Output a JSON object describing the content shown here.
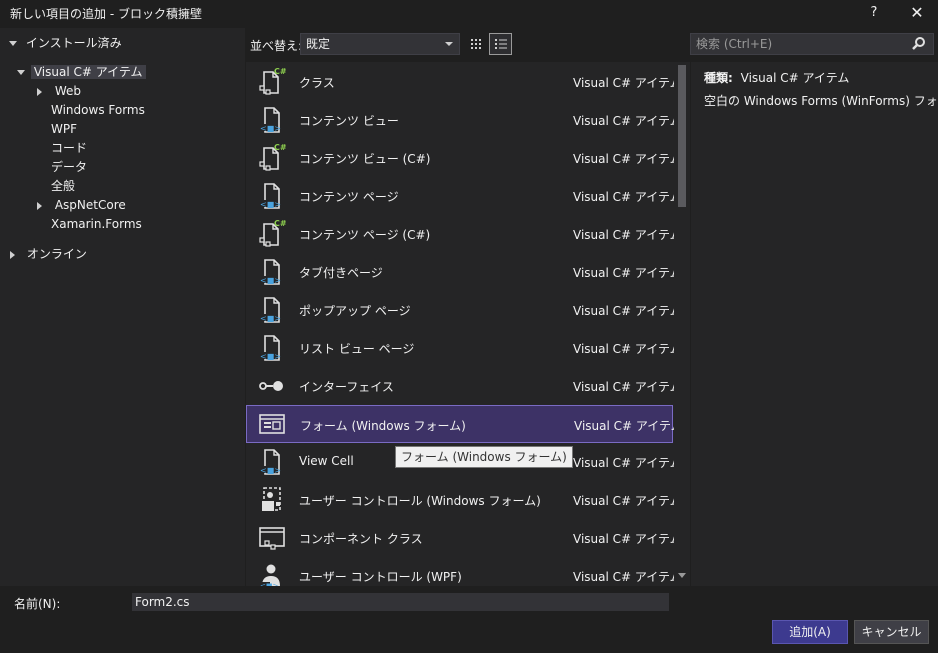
{
  "window": {
    "title": "新しい項目の追加 - ブロック積擁壁",
    "help_label": "?",
    "close_label": "✕"
  },
  "tree": {
    "installed_label": "インストール済み",
    "items": [
      {
        "label": "Visual C# アイテム",
        "expanded": true,
        "selected": true
      },
      {
        "label": "Web",
        "expandable": true
      },
      {
        "label": "Windows Forms"
      },
      {
        "label": "WPF"
      },
      {
        "label": "コード"
      },
      {
        "label": "データ"
      },
      {
        "label": "全般"
      },
      {
        "label": "AspNetCore",
        "expandable": true
      },
      {
        "label": "Xamarin.Forms"
      }
    ],
    "online_label": "オンライン"
  },
  "toolbar": {
    "sort_label": "並べ替え:",
    "sort_value": "既定",
    "grid_view_icon": "grid-view-icon",
    "list_view_icon": "list-view-icon"
  },
  "search": {
    "placeholder": "検索 (Ctrl+E)",
    "icon": "search-icon"
  },
  "templates": [
    {
      "name": "クラス",
      "type": "Visual C# アイテム",
      "icon": "class-csharp-icon"
    },
    {
      "name": "コンテンツ ビュー",
      "type": "Visual C# アイテム",
      "icon": "xaml-file-icon"
    },
    {
      "name": "コンテンツ ビュー (C#)",
      "type": "Visual C# アイテム",
      "icon": "class-csharp-icon"
    },
    {
      "name": "コンテンツ ページ",
      "type": "Visual C# アイテム",
      "icon": "xaml-file-icon"
    },
    {
      "name": "コンテンツ ページ (C#)",
      "type": "Visual C# アイテム",
      "icon": "class-csharp-icon"
    },
    {
      "name": "タブ付きページ",
      "type": "Visual C# アイテム",
      "icon": "xaml-file-icon"
    },
    {
      "name": "ポップアップ ページ",
      "type": "Visual C# アイテム",
      "icon": "xaml-file-icon"
    },
    {
      "name": "リスト ビュー ページ",
      "type": "Visual C# アイテム",
      "icon": "xaml-file-icon"
    },
    {
      "name": "インターフェイス",
      "type": "Visual C# アイテム",
      "icon": "interface-icon"
    },
    {
      "name": "フォーム (Windows フォーム)",
      "type": "Visual C# アイテム",
      "icon": "windows-form-icon",
      "selected": true
    },
    {
      "name": "View Cell",
      "type": "Visual C# アイテム",
      "icon": "xaml-file-icon"
    },
    {
      "name": "ユーザー コントロール (Windows フォーム)",
      "type": "Visual C# アイテム",
      "icon": "user-control-icon"
    },
    {
      "name": "コンポーネント クラス",
      "type": "Visual C# アイテム",
      "icon": "component-class-icon"
    },
    {
      "name": "ユーザー コントロール (WPF)",
      "type": "Visual C# アイテム",
      "icon": "user-control-wpf-icon"
    }
  ],
  "tooltip": "フォーム (Windows フォーム)",
  "details": {
    "type_label": "種類:",
    "type_value": "Visual C# アイテム",
    "description": "空白の Windows Forms (WinForms) フォーム"
  },
  "footer": {
    "name_label": "名前(N):",
    "name_value": "Form2.cs",
    "add_label": "追加(A)",
    "cancel_label": "キャンセル"
  },
  "colors": {
    "background": "#1f1f1f",
    "panel": "#252526",
    "selection": "#3d3266",
    "selection_border": "#7a6bc4",
    "accent_button": "#3d3a8f",
    "csharp_green": "#8fd14f",
    "icon_blue": "#4aa3df"
  }
}
